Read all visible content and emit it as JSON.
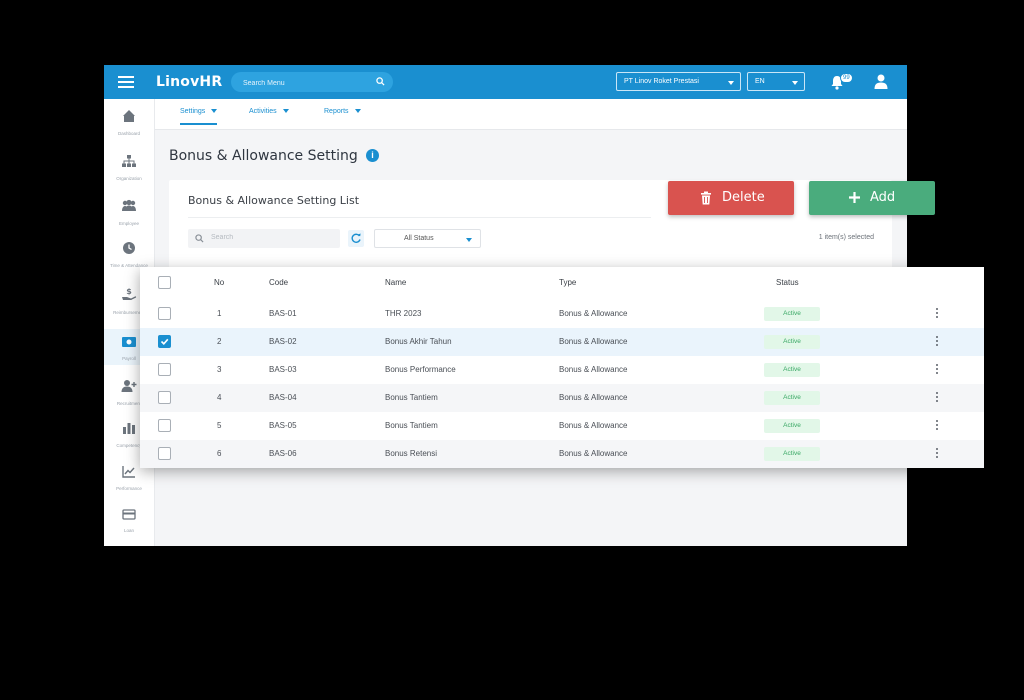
{
  "topbar": {
    "logo": "LinovHR",
    "search_placeholder": "Search Menu",
    "company": "PT Linov Roket Prestasi",
    "language": "EN",
    "notification_count": "99",
    "color": "#1a8fd0"
  },
  "subnav": {
    "tabs": [
      {
        "label": "Settings",
        "active": true
      },
      {
        "label": "Activities"
      },
      {
        "label": "Reports"
      }
    ]
  },
  "sidebar": {
    "items": [
      {
        "label": "Dashboard",
        "icon": "dashboard-icon"
      },
      {
        "label": "Organization",
        "icon": "org-chart-icon"
      },
      {
        "label": "Employee",
        "icon": "people-icon"
      },
      {
        "label": "Time & Attendance",
        "icon": "clock-icon"
      },
      {
        "label": "Reimbursement",
        "icon": "money-hand-icon"
      },
      {
        "label": "Payroll",
        "icon": "payroll-icon",
        "active": true
      },
      {
        "label": "Recruitment",
        "icon": "user-plus-icon"
      },
      {
        "label": "Competency",
        "icon": "bar-chart-icon"
      },
      {
        "label": "Performance",
        "icon": "trend-icon"
      },
      {
        "label": "Loan",
        "icon": "card-icon"
      }
    ]
  },
  "page": {
    "title": "Bonus & Allowance Setting",
    "info": "i"
  },
  "list": {
    "title": "Bonus & Allowance Setting List",
    "search_placeholder": "Search",
    "status_filter": "All Status",
    "selected_count": "1 item(s) selected"
  },
  "actions": {
    "delete_label": "Delete",
    "add_label": "Add",
    "delete_color": "#d9534f",
    "add_color": "#4aac7d"
  },
  "table": {
    "columns": {
      "no": "No",
      "code": "Code",
      "name": "Name",
      "type": "Type",
      "status": "Status"
    },
    "rows": [
      {
        "no": "1",
        "code": "BAS-01",
        "name": "THR 2023",
        "type": "Bonus & Allowance",
        "status": "Active",
        "checked": false
      },
      {
        "no": "2",
        "code": "BAS-02",
        "name": "Bonus Akhir Tahun",
        "type": "Bonus & Allowance",
        "status": "Active",
        "checked": true
      },
      {
        "no": "3",
        "code": "BAS-03",
        "name": "Bonus Performance",
        "type": "Bonus & Allowance",
        "status": "Active",
        "checked": false
      },
      {
        "no": "4",
        "code": "BAS-04",
        "name": "Bonus Tantiem",
        "type": "Bonus & Allowance",
        "status": "Active",
        "checked": false
      },
      {
        "no": "5",
        "code": "BAS-05",
        "name": "Bonus Tantiem",
        "type": "Bonus & Allowance",
        "status": "Active",
        "checked": false
      },
      {
        "no": "6",
        "code": "BAS-06",
        "name": "Bonus Retensi",
        "type": "Bonus & Allowance",
        "status": "Active",
        "checked": false
      }
    ]
  }
}
